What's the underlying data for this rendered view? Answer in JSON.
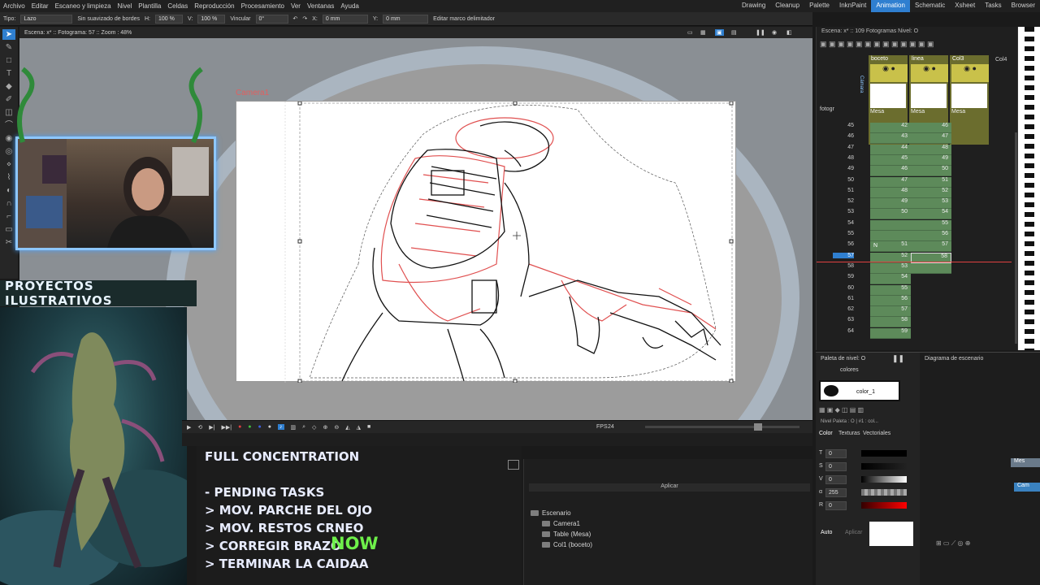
{
  "menu": [
    "Archivo",
    "Editar",
    "Escaneo y limpieza",
    "Nivel",
    "Plantilla",
    "Celdas",
    "Reproducción",
    "Procesamiento",
    "Ver",
    "Ventanas",
    "Ayuda"
  ],
  "rooms": {
    "items": [
      "Drawing",
      "Cleanup",
      "Palette",
      "InknPaint",
      "Animation",
      "Schematic",
      "Xsheet",
      "Tasks",
      "Browser"
    ],
    "active": "Animation"
  },
  "toolopts": {
    "tipo_label": "Tipo:",
    "tipo_value": "Lazo",
    "smooth_label": "Sin suavizado de bordes",
    "h_label": "H:",
    "h_value": "100 %",
    "v_label": "V:",
    "v_value": "100 %",
    "link_label": "Vincular",
    "angle_value": "0°",
    "x_label": "X:",
    "x_value": "0 mm",
    "y_label": "Y:",
    "y_value": "0 mm",
    "bbox_label": "Editar marco delimitador"
  },
  "viewer": {
    "header": "Escena: x* :: Fotograma: 57 :: Zoom : 48%",
    "camera_label": "Camera1"
  },
  "overlay": {
    "banner": "PROYECTOS ILUSTRATIVOS",
    "heading": "FULL CONCENTRATION",
    "tasks": [
      "- PENDING TASKS",
      "> MOV. PARCHE DEL OJO",
      "> MOV. RESTOS CRNEO",
      "> CORREGIR BRAZO",
      "> TERMINAR LA CAIDAA"
    ],
    "now_tag": "NOW"
  },
  "playback": {
    "fps_label": "FPS",
    "fps_value": "24"
  },
  "xsheet": {
    "header": "Escena: x* :: 109 Fotogramas  Nivel: O",
    "camera_label": "Cámara",
    "level_label": "fotogr",
    "columns": [
      {
        "name": "boceto",
        "footer": "Mesa"
      },
      {
        "name": "linea",
        "footer": "Mesa"
      },
      {
        "name": "Col3",
        "footer": "Mesa"
      },
      {
        "name": "Col4",
        "footer": ""
      }
    ],
    "frames": [
      "45",
      "46",
      "47",
      "48",
      "49",
      "50",
      "51",
      "52",
      "53",
      "54",
      "55",
      "56",
      "57",
      "58",
      "59",
      "60",
      "61",
      "62",
      "63",
      "64"
    ],
    "colA": [
      "42",
      "43",
      "44",
      "45",
      "46",
      "47",
      "48",
      "49",
      "50",
      "",
      "",
      "51",
      "52",
      "53",
      "54",
      "55",
      "56",
      "57",
      "58",
      "59"
    ],
    "colB": [
      "46",
      "47",
      "48",
      "49",
      "50",
      "51",
      "52",
      "53",
      "54",
      "55",
      "56",
      "57",
      "58",
      "",
      "",
      "",
      "",
      "",
      "",
      ""
    ],
    "current_frame": "57",
    "marker_n": "N"
  },
  "palette": {
    "title": "Paleta de nivel: O",
    "tab": "colores",
    "style_name": "color_1",
    "level_palette": "Nivel Paleta : O | #1 : col...",
    "tabs": [
      "Color",
      "Texturas",
      "Vectoriales"
    ],
    "channels": [
      {
        "label": "T",
        "value": "0"
      },
      {
        "label": "S",
        "value": "0"
      },
      {
        "label": "V",
        "value": "0"
      },
      {
        "label": "α",
        "value": "255"
      },
      {
        "label": "R",
        "value": "0"
      }
    ],
    "auto_label": "Auto",
    "apply_label": "Aplicar"
  },
  "schematic": {
    "title": "Diagrama de escenario",
    "node1": "Mes",
    "node2": "Cam"
  },
  "scenecast": {
    "apply": "Aplicar",
    "root": "Escenario",
    "items": [
      "Camera1",
      "Table (Mesa)",
      "Col1 (boceto)"
    ]
  },
  "colors": {
    "accent": "#2f7fd0",
    "cell_green": "#5d8a5a",
    "column_header": "#6b6d2e",
    "sketch_red": "#e05050",
    "webcam_border": "#8ec7ff",
    "now_green": "#6ef04a"
  }
}
